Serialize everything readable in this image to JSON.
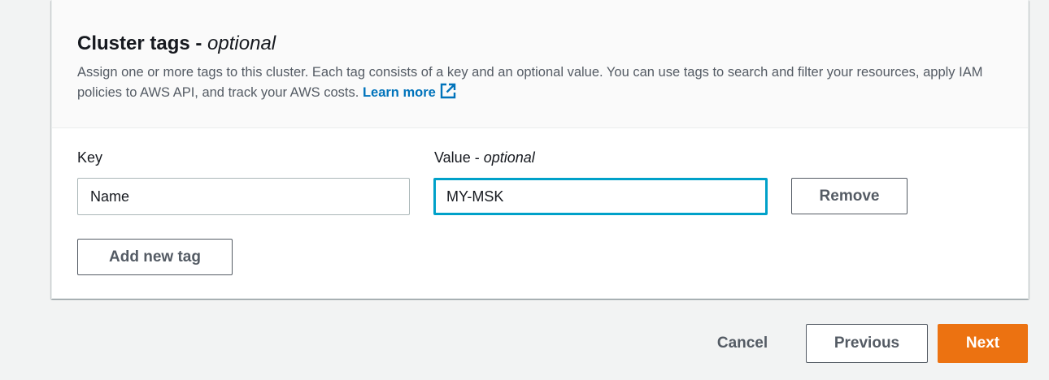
{
  "section": {
    "title": "Cluster tags -",
    "title_optional": "optional",
    "description": "Assign one or more tags to this cluster. Each tag consists of a key and an optional value. You can use tags to search and filter your resources, apply IAM policies to AWS API, and track your AWS costs.",
    "learn_more": "Learn more",
    "learn_more_icon": "external-link-icon"
  },
  "tag": {
    "key_label": "Key",
    "value_label": "Value -",
    "value_label_optional": "optional",
    "key_value": "Name",
    "value_value": "MY-MSK",
    "remove_label": "Remove"
  },
  "add_tag_label": "Add new tag",
  "footer": {
    "cancel_label": "Cancel",
    "previous_label": "Previous",
    "next_label": "Next"
  },
  "colors": {
    "primary": "#ec7211",
    "link": "#0073bb",
    "focus": "#00a1c9"
  }
}
